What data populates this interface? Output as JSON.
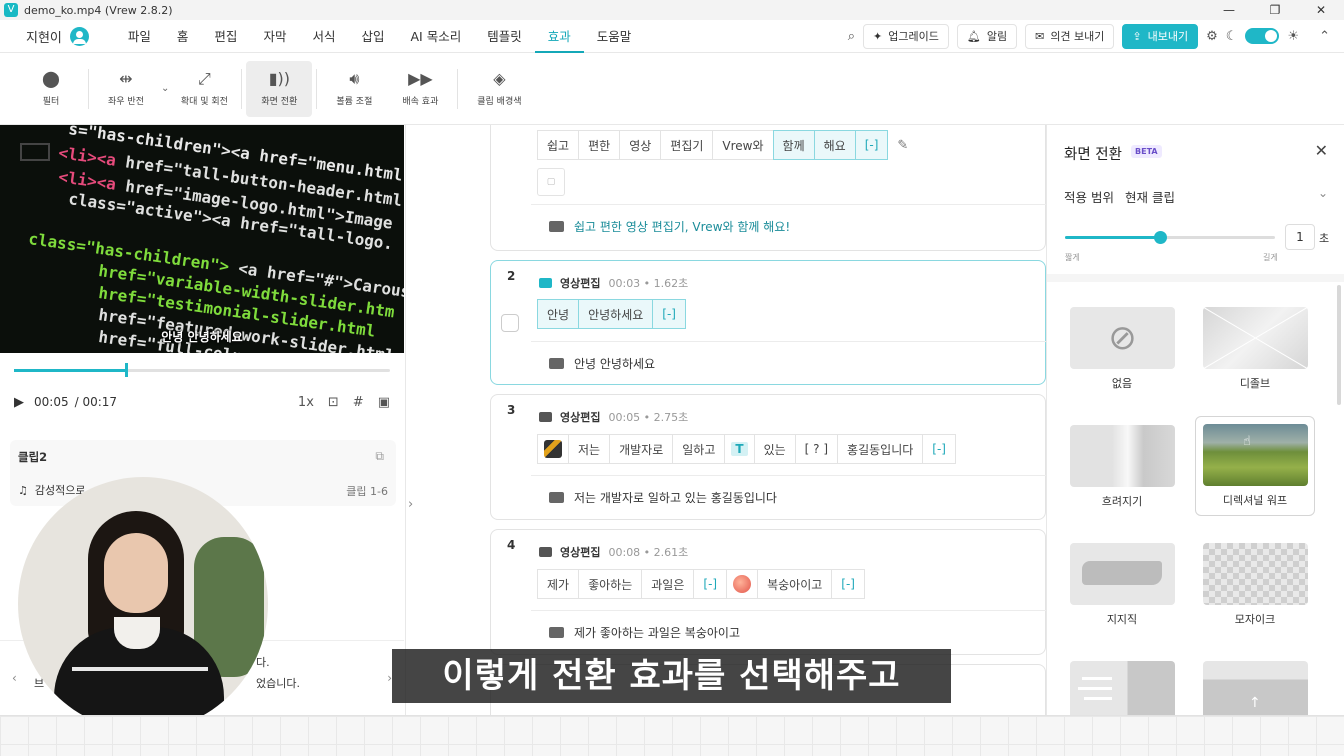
{
  "window": {
    "title": "demo_ko.mp4 (Vrew 2.8.2)",
    "minimize": "—",
    "maximize": "❐",
    "close": "✕"
  },
  "menubar": {
    "user": "지현이",
    "items": [
      "파일",
      "홈",
      "편집",
      "자막",
      "서식",
      "삽입",
      "AI 목소리",
      "템플릿",
      "효과",
      "도움말"
    ],
    "active": "효과",
    "upgrade": "업그레이드",
    "alerts": "알림",
    "feedback": "의견 보내기",
    "export": "내보내기"
  },
  "toolbar": {
    "filter": "필터",
    "flip": "좌우 반전",
    "zoom_rotate": "확대 및 회전",
    "transition": "화면 전환",
    "volume": "볼륨 조절",
    "speed": "배속 효과",
    "clip_bg": "클립 배경색"
  },
  "player": {
    "subtitle": "안녕 안녕하세요",
    "current_time": "00:05",
    "total_time": "/ 00:17",
    "speed": "1x",
    "progress": 0.3
  },
  "clip_card": {
    "name": "클립2",
    "music": "감성적으로",
    "range": "클립 1-6"
  },
  "left_bottom": {
    "line1": "다.",
    "line2": "었습니다.",
    "line0": "브"
  },
  "script": {
    "clip1": {
      "words": [
        "쉽고",
        "편한",
        "영상",
        "편집기",
        "Vrew와",
        "함께",
        "해요",
        "[-]"
      ],
      "sentence": "쉽고 편한 영상 편집기, Vrew와 함께 해요!"
    },
    "clip2": {
      "num": "2",
      "name": "영상편집",
      "time": "00:03 • 1.62초",
      "words": [
        "안녕",
        "안녕하세요",
        "[-]"
      ],
      "sentence": "안녕 안녕하세요"
    },
    "clip3": {
      "num": "3",
      "name": "영상편집",
      "time": "00:05 • 2.75초",
      "words": [
        "저는",
        "개발자로",
        "일하고",
        "T",
        "있는",
        "[ ? ]",
        "홍길동입니다",
        "[-]"
      ],
      "sentence": "저는 개발자로 일하고 있는 홍길동입니다"
    },
    "clip4": {
      "num": "4",
      "name": "영상편집",
      "time": "00:08 • 2.61초",
      "words": [
        "제가",
        "좋아하는",
        "과일은",
        "[-]",
        "복숭아이고",
        "[-]"
      ],
      "sentence": "제가 좋아하는 과일은 복숭아이고"
    }
  },
  "transition_panel": {
    "title": "화면 전환",
    "beta": "BETA",
    "scope_label": "적용 범위",
    "scope_value": "현재 클립",
    "duration": "1",
    "unit": "초",
    "fast": "짧게",
    "slow": "길게",
    "slider": 0.45,
    "options": [
      "없음",
      "디졸브",
      "흐려지기",
      "디렉셔널 워프",
      "지지직",
      "모자이크"
    ],
    "selected": "디렉셔널 워프"
  },
  "caption": "이렇게 전환 효과를 선택해주고",
  "colors": {
    "accent": "#1fb7c7",
    "beta": "#6a4fc9"
  }
}
